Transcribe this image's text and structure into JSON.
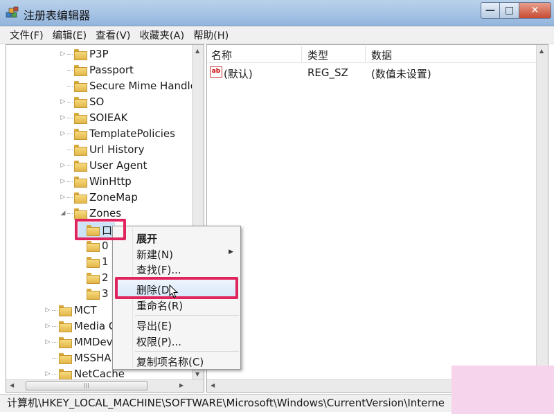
{
  "window": {
    "title": "注册表编辑器"
  },
  "menu": [
    "文件(F)",
    "编辑(E)",
    "查看(V)",
    "收藏夹(A)",
    "帮助(H)"
  ],
  "tree": {
    "nodes": [
      {
        "label": "P3P",
        "expandable": true
      },
      {
        "label": "Passport",
        "expandable": false
      },
      {
        "label": "Secure Mime Handle",
        "expandable": false
      },
      {
        "label": "SO",
        "expandable": true
      },
      {
        "label": "SOIEAK",
        "expandable": true
      },
      {
        "label": "TemplatePolicies",
        "expandable": true
      },
      {
        "label": "Url History",
        "expandable": false
      },
      {
        "label": "User Agent",
        "expandable": true
      },
      {
        "label": "WinHttp",
        "expandable": true
      },
      {
        "label": "ZoneMap",
        "expandable": true
      },
      {
        "label": "Zones",
        "expandable": true,
        "expanded": true
      },
      {
        "label": "口",
        "expandable": false,
        "selected": true
      },
      {
        "label": "0",
        "expandable": false
      },
      {
        "label": "1",
        "expandable": false
      },
      {
        "label": "2",
        "expandable": false
      },
      {
        "label": "3",
        "expandable": false
      },
      {
        "label": "MCT",
        "expandable": true
      },
      {
        "label": "Media C",
        "expandable": true
      },
      {
        "label": "MMDev",
        "expandable": true
      },
      {
        "label": "MSSHA",
        "expandable": false
      },
      {
        "label": "NetCache",
        "expandable": true
      }
    ]
  },
  "list": {
    "columns": [
      "名称",
      "类型",
      "数据"
    ],
    "rows": [
      {
        "name": "(默认)",
        "type": "REG_SZ",
        "data": "(数值未设置)",
        "icon": "ab-string-icon"
      }
    ]
  },
  "context_menu": {
    "items": [
      "展开",
      "新建(N)",
      "查找(F)...",
      "删除(D)",
      "重命名(R)",
      "导出(E)",
      "权限(P)...",
      "复制项名称(C)"
    ],
    "hovered": "删除(D)"
  },
  "status": {
    "path": "计算机\\HKEY_LOCAL_MACHINE\\SOFTWARE\\Microsoft\\Windows\\CurrentVersion\\Interne"
  },
  "colors": {
    "highlight": "#e0245e",
    "titlebar": "#a9c5e6",
    "folder": "#e2b64a",
    "pink_block": "#f6d4ec"
  }
}
